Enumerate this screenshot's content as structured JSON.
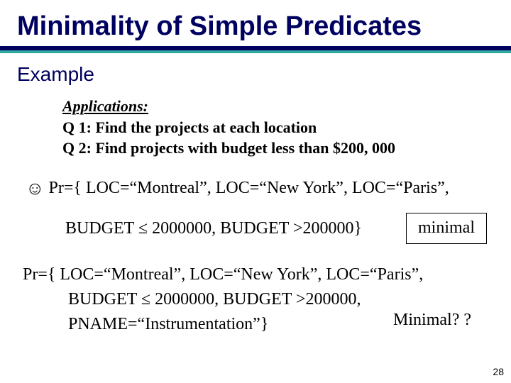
{
  "title": "Minimality of Simple Predicates",
  "subhead": "Example",
  "apps": {
    "header": "Applications:",
    "q1": "Q 1: Find the projects at each location",
    "q2": "Q 2: Find projects with budget less than $200, 000"
  },
  "pr1": {
    "face": "☺",
    "line1": " Pr={ LOC=“Montreal”, LOC=“New York”, LOC=“Paris”,",
    "budget": "BUDGET ≤ 2000000,  BUDGET >200000}",
    "minimal_label": "minimal"
  },
  "pr2": {
    "line1": "Pr={ LOC=“Montreal”, LOC=“New York”, LOC=“Paris”,",
    "line2": "BUDGET ≤ 2000000,   BUDGET >200000,",
    "line3": "PNAME=“Instrumentation”}",
    "minimal_q": "Minimal? ?"
  },
  "page_number": "28"
}
